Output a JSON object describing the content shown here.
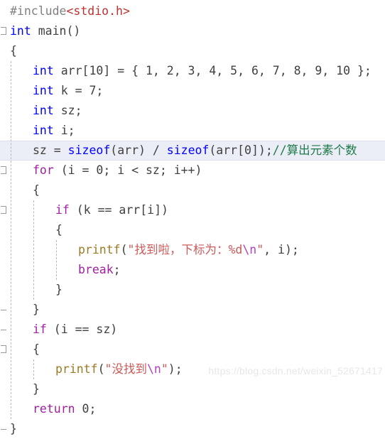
{
  "editor": {
    "language": "c",
    "highlighted_line_index": 6,
    "colors": {
      "background": "#ffffff",
      "plain_text": "#404040",
      "keyword": "#0000ff",
      "control_keyword": "#a020a0",
      "preprocessor": "#808080",
      "header_name": "#c03030",
      "function": "#9a7a24",
      "string": "#cb5a5a",
      "escape": "#b040c0",
      "comment": "#1f7a4a",
      "current_line_highlight": "#eceef7",
      "indent_guide": "#b9b9b9",
      "collapse_marker": "#9a9a9a",
      "watermark": "#e7e7e7"
    },
    "lines": [
      {
        "n": 1,
        "indent": 0,
        "collapse": "none",
        "highlight": false,
        "tokens": [
          {
            "t": "#include",
            "c": "pre"
          },
          {
            "t": "<stdio.h>",
            "c": "hdr"
          }
        ]
      },
      {
        "n": 2,
        "indent": 0,
        "collapse": "box",
        "highlight": false,
        "tokens": [
          {
            "t": "int",
            "c": "kw"
          },
          {
            "t": " main()",
            "c": "pl"
          }
        ]
      },
      {
        "n": 3,
        "indent": 0,
        "collapse": "none",
        "highlight": false,
        "tokens": [
          {
            "t": "{",
            "c": "pl"
          }
        ]
      },
      {
        "n": 4,
        "indent": 1,
        "collapse": "none",
        "highlight": false,
        "tokens": [
          {
            "t": "int",
            "c": "kw"
          },
          {
            "t": " arr[10] = { 1, 2, 3, 4, 5, 6, 7, 8, 9, 10 };",
            "c": "pl"
          }
        ]
      },
      {
        "n": 5,
        "indent": 1,
        "collapse": "none",
        "highlight": false,
        "tokens": [
          {
            "t": "int",
            "c": "kw"
          },
          {
            "t": " k = 7;",
            "c": "pl"
          }
        ]
      },
      {
        "n": 6,
        "indent": 1,
        "collapse": "none",
        "highlight": false,
        "tokens": [
          {
            "t": "int",
            "c": "kw"
          },
          {
            "t": " sz;",
            "c": "pl"
          }
        ]
      },
      {
        "n": 7,
        "indent": 1,
        "collapse": "none",
        "highlight": false,
        "tokens": [
          {
            "t": "int",
            "c": "kw"
          },
          {
            "t": " i;",
            "c": "pl"
          }
        ]
      },
      {
        "n": 8,
        "indent": 1,
        "collapse": "none",
        "highlight": true,
        "tokens": [
          {
            "t": "sz = ",
            "c": "pl"
          },
          {
            "t": "sizeof",
            "c": "kw"
          },
          {
            "t": "(arr) / ",
            "c": "pl"
          },
          {
            "t": "sizeof",
            "c": "kw"
          },
          {
            "t": "(arr[0]);",
            "c": "pl"
          },
          {
            "t": "//算出元素个数",
            "c": "cmt"
          }
        ]
      },
      {
        "n": 9,
        "indent": 1,
        "collapse": "box",
        "highlight": false,
        "tokens": [
          {
            "t": "for",
            "c": "ctl"
          },
          {
            "t": " (i = 0; i < sz; i++)",
            "c": "pl"
          }
        ]
      },
      {
        "n": 10,
        "indent": 1,
        "collapse": "none",
        "highlight": false,
        "tokens": [
          {
            "t": "{",
            "c": "pl"
          }
        ]
      },
      {
        "n": 11,
        "indent": 2,
        "collapse": "box",
        "highlight": false,
        "tokens": [
          {
            "t": "if",
            "c": "ctl"
          },
          {
            "t": " (k == arr[i])",
            "c": "pl"
          }
        ]
      },
      {
        "n": 12,
        "indent": 2,
        "collapse": "none",
        "highlight": false,
        "tokens": [
          {
            "t": "{",
            "c": "pl"
          }
        ]
      },
      {
        "n": 13,
        "indent": 3,
        "collapse": "none",
        "highlight": false,
        "tokens": [
          {
            "t": "printf",
            "c": "fn"
          },
          {
            "t": "(",
            "c": "pl"
          },
          {
            "t": "\"找到啦，下标为：%d",
            "c": "str"
          },
          {
            "t": "\\n",
            "c": "esc"
          },
          {
            "t": "\"",
            "c": "str"
          },
          {
            "t": ", i);",
            "c": "pl"
          }
        ]
      },
      {
        "n": 14,
        "indent": 3,
        "collapse": "none",
        "highlight": false,
        "tokens": [
          {
            "t": "break",
            "c": "ctl"
          },
          {
            "t": ";",
            "c": "pl"
          }
        ]
      },
      {
        "n": 15,
        "indent": 2,
        "collapse": "none",
        "highlight": false,
        "tokens": [
          {
            "t": "}",
            "c": "pl"
          }
        ]
      },
      {
        "n": 16,
        "indent": 1,
        "collapse": "dash",
        "highlight": false,
        "tokens": [
          {
            "t": "}",
            "c": "pl"
          }
        ]
      },
      {
        "n": 17,
        "indent": 1,
        "collapse": "dash",
        "highlight": false,
        "tokens": [
          {
            "t": "if",
            "c": "ctl"
          },
          {
            "t": " (i == sz)",
            "c": "pl"
          }
        ]
      },
      {
        "n": 18,
        "indent": 1,
        "collapse": "box",
        "highlight": false,
        "tokens": [
          {
            "t": "{",
            "c": "pl"
          }
        ]
      },
      {
        "n": 19,
        "indent": 2,
        "collapse": "none",
        "highlight": false,
        "tokens": [
          {
            "t": "printf",
            "c": "fn"
          },
          {
            "t": "(",
            "c": "pl"
          },
          {
            "t": "\"没找到",
            "c": "str"
          },
          {
            "t": "\\n",
            "c": "esc"
          },
          {
            "t": "\"",
            "c": "str"
          },
          {
            "t": ");",
            "c": "pl"
          }
        ]
      },
      {
        "n": 20,
        "indent": 1,
        "collapse": "none",
        "highlight": false,
        "tokens": [
          {
            "t": "}",
            "c": "pl"
          }
        ]
      },
      {
        "n": 21,
        "indent": 1,
        "collapse": "none",
        "highlight": false,
        "tokens": [
          {
            "t": "return",
            "c": "ctl"
          },
          {
            "t": " 0;",
            "c": "pl"
          }
        ]
      },
      {
        "n": 22,
        "indent": 0,
        "collapse": "dash",
        "highlight": false,
        "tokens": [
          {
            "t": "}",
            "c": "pl"
          }
        ]
      }
    ]
  },
  "watermark": {
    "text": "https://blog.csdn.net/weixin_52671417"
  }
}
